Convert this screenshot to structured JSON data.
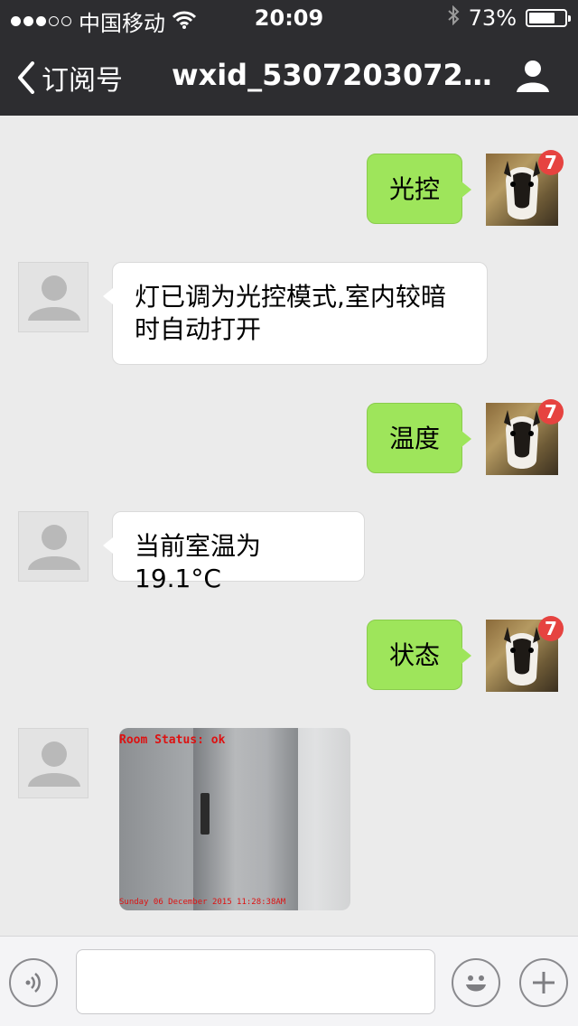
{
  "status_bar": {
    "carrier": "中国移动",
    "time": "20:09",
    "battery": "73%",
    "battery_level": 0.73,
    "signal_dots_filled": 3,
    "signal_dots_total": 5
  },
  "nav": {
    "back_label": "订阅号",
    "title": "wxid_5307203072…"
  },
  "messages": [
    {
      "direction": "out",
      "text": "光控",
      "badge": "7"
    },
    {
      "direction": "in",
      "text": "灯已调为光控模式,室内较暗时自动打开"
    },
    {
      "direction": "out",
      "text": "温度",
      "badge": "7"
    },
    {
      "direction": "in",
      "text": "当前室温为19.1°C"
    },
    {
      "direction": "out",
      "text": "状态",
      "badge": "7"
    },
    {
      "direction": "in",
      "image": {
        "overlay_text": "Room Status: ok",
        "timestamp": "Sunday 06 December 2015 11:28:38AM"
      }
    }
  ],
  "input_bar": {
    "voice_icon": "voice-icon",
    "emoji_icon": "emoji-icon",
    "plus_icon": "plus-icon",
    "input_value": ""
  },
  "colors": {
    "header_bg": "#2d2d30",
    "chat_bg": "#ebebeb",
    "outgoing_bubble": "#9ee55b",
    "incoming_bubble": "#ffffff",
    "badge": "#e64340"
  }
}
